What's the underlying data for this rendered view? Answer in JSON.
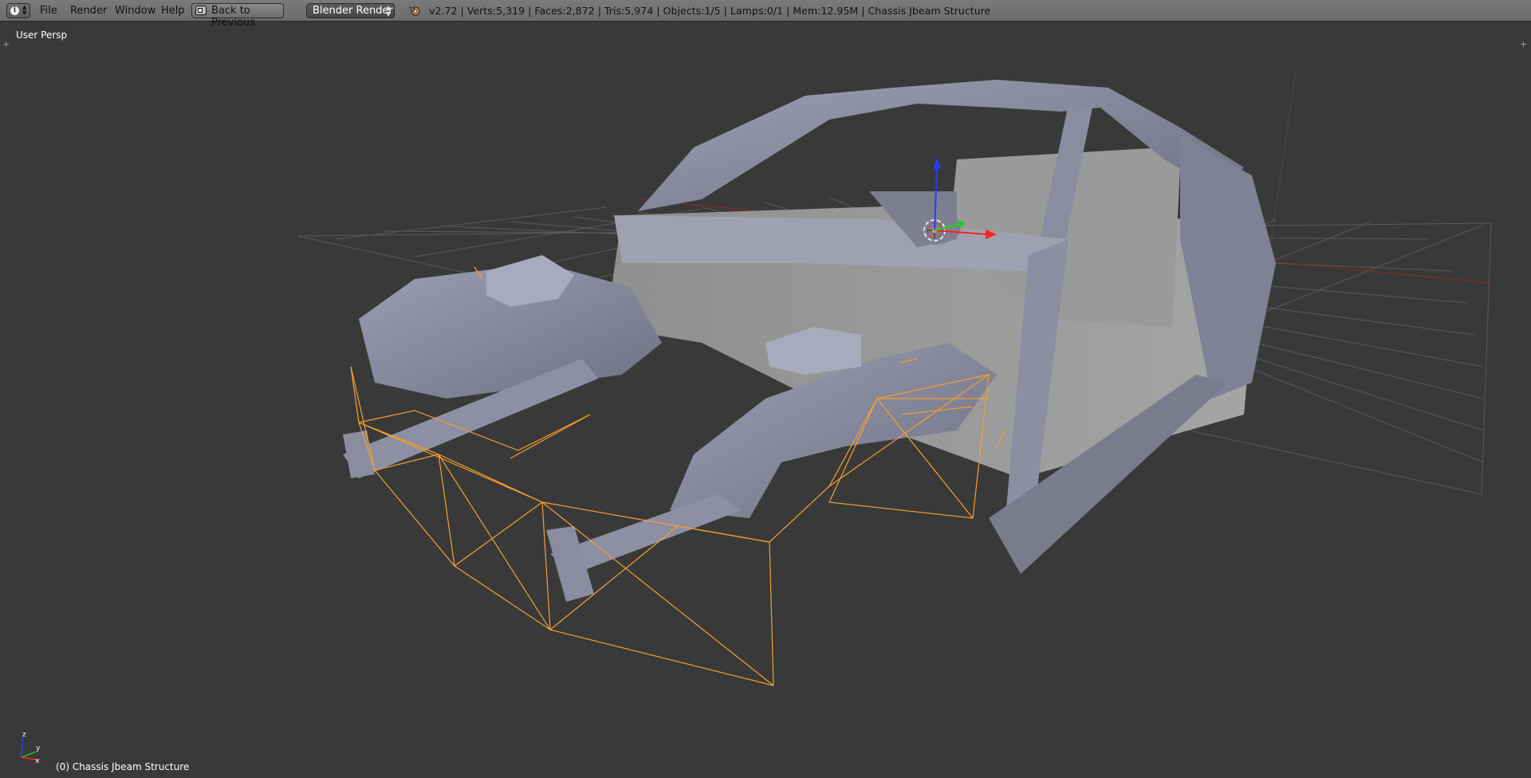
{
  "header": {
    "menus": [
      "File",
      "Render",
      "Window",
      "Help"
    ],
    "back_button": "Back to Previous",
    "render_engine": "Blender Render",
    "stats": "v2.72 | Verts:5,319 | Faces:2,872 | Tris:5,974 | Objects:1/5 | Lamps:0/1 | Mem:12.95M | Chassis Jbeam Structure"
  },
  "viewport": {
    "view_label": "User Persp",
    "object_label": "(0) Chassis Jbeam Structure",
    "axis_labels": {
      "x": "x",
      "y": "y",
      "z": "z"
    }
  },
  "colors": {
    "header_bg": "#6f6f6f",
    "viewport_bg": "#393939",
    "mesh": "#8d8fa3",
    "selected_wire": "#f5a030",
    "axis_x": "#ff2020",
    "axis_y": "#20d020",
    "axis_z": "#2040ff"
  }
}
